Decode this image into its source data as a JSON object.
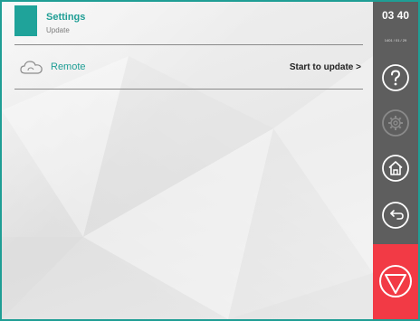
{
  "header": {
    "title": "Settings",
    "subtitle": "Update"
  },
  "rows": [
    {
      "label": "Remote",
      "action": "Start to update >",
      "icon": "cloud-icon"
    }
  ],
  "sidebar": {
    "time": "03 40",
    "date": "1401 / 01 / 29",
    "buttons": [
      "help-icon",
      "gear-icon",
      "home-icon",
      "back-icon",
      "stop-icon"
    ],
    "stop_color": "#f23a45"
  },
  "colors": {
    "accent": "#1f9e95",
    "sidebar": "#5e5e5e"
  }
}
